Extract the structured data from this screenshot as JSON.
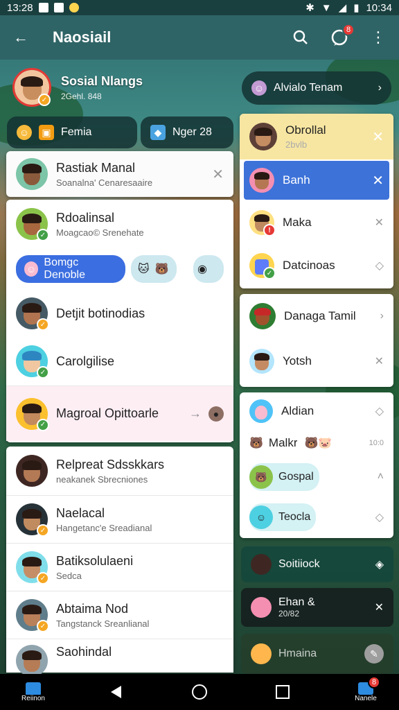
{
  "status": {
    "time_left": "13:28",
    "time_right": "10:34"
  },
  "appbar": {
    "title": "Naosiail",
    "badge": "8"
  },
  "profile": {
    "name": "Sosial Nlangs",
    "sub": "2Gehl. 848"
  },
  "top_left_pills": [
    {
      "label": "Femia"
    },
    {
      "label": "Nger 28"
    }
  ],
  "top_right_pill": {
    "label": "Alvialo Tenam"
  },
  "left_card1": {
    "title": "Rastiak Manal",
    "sub": "Soanalna' Cenaresaaire"
  },
  "left_card2": {
    "row1": {
      "title": "Rdoalinsal",
      "sub": "Moagcao© Srenehate"
    },
    "chip": "Bomgc Denoble",
    "row2": {
      "title": "Detjit botinodias"
    },
    "row3": {
      "title": "Carolgilise"
    },
    "row4": {
      "title": "Magroal Opittoarle"
    }
  },
  "left_card3": [
    {
      "title": "Relpreat Sdsskkars",
      "sub": "neakanek Sbrecniones"
    },
    {
      "title": "Naelacal",
      "sub": "Hangetanc'e Sreadianal"
    },
    {
      "title": "Batiksolulaeni",
      "sub": "Sedca"
    },
    {
      "title": "Abtaima Nod",
      "sub": "Tangstanck Sreanlianal"
    },
    {
      "title": "Saohindal",
      "sub": ""
    }
  ],
  "right_card1": [
    {
      "title": "Obrollal",
      "sub": "2bvlb"
    },
    {
      "title": "Banh"
    },
    {
      "title": "Maka"
    },
    {
      "title": "Datcinoas"
    }
  ],
  "right_card2": [
    {
      "title": "Danaga Tamil"
    },
    {
      "title": "Yotsh"
    }
  ],
  "right_card3": {
    "row1": "Aldian",
    "row2": "Malkr",
    "row2_meta": "10:0",
    "chip1": "Gospal",
    "chip2": "Teocla"
  },
  "right_dark": [
    {
      "title": "Soitiiock"
    },
    {
      "title": "Ehan &",
      "sub": "20/82"
    },
    {
      "title": "Hmaina"
    }
  ],
  "navbar": {
    "left_label": "Reiinon",
    "right_label": "Nanele",
    "right_badge": "8"
  },
  "colors": {
    "appbar": "#2f6466",
    "selected_row": "#3d72d9",
    "highlight_row": "#fdeef4",
    "yellow_row": "#f7e6a2",
    "chip_blue": "#3b6ee0"
  }
}
